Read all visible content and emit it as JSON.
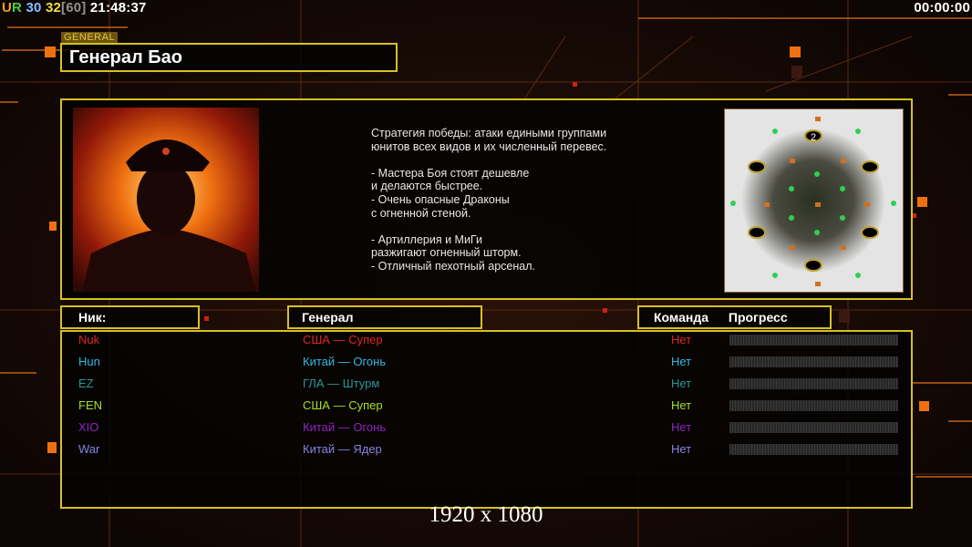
{
  "hud": {
    "ur_u": "U",
    "ur_r": "R",
    "num1": "30",
    "num2": "32",
    "bracket": "[60]",
    "clock": "21:48:37",
    "timer": "00:00:00"
  },
  "general": {
    "tag": "GENERAL",
    "name": "Генерал Бао",
    "description": "Стратегия победы: атаки едиными группами\nюнитов всех видов и их численный перевес.\n\n- Мастера Боя стоят дешевле\nи делаются быстрее.\n- Очень опасные Драконы\nс огненной стеной.\n\n- Артиллерия и МиГи\nразжигают огненный шторм.\n- Отличный пехотный арсенал.",
    "map_player_label": "2"
  },
  "headers": {
    "nick": "Ник:",
    "general": "Генерал",
    "team": "Команда",
    "progress": "Прогресс"
  },
  "players": [
    {
      "nick": "Nuk",
      "general": "США — Супер",
      "team": "Нет",
      "progress": 0,
      "color": "#e02424"
    },
    {
      "nick": "Hun",
      "general": "Китай — Огонь",
      "team": "Нет",
      "progress": 0,
      "color": "#34b6e0"
    },
    {
      "nick": "EZ",
      "general": "ГЛА — Штурм",
      "team": "Нет",
      "progress": 0,
      "color": "#2a9696"
    },
    {
      "nick": "FEN",
      "general": "США — Супер",
      "team": "Нет",
      "progress": 0,
      "color": "#a4e024"
    },
    {
      "nick": "XIO",
      "general": "Китай — Огонь",
      "team": "Нет",
      "progress": 0,
      "color": "#9024c4"
    },
    {
      "nick": "War",
      "general": "Китай — Ядер",
      "team": "Нет",
      "progress": 0,
      "color": "#8484e0"
    }
  ],
  "resolution": "1920 x 1080"
}
